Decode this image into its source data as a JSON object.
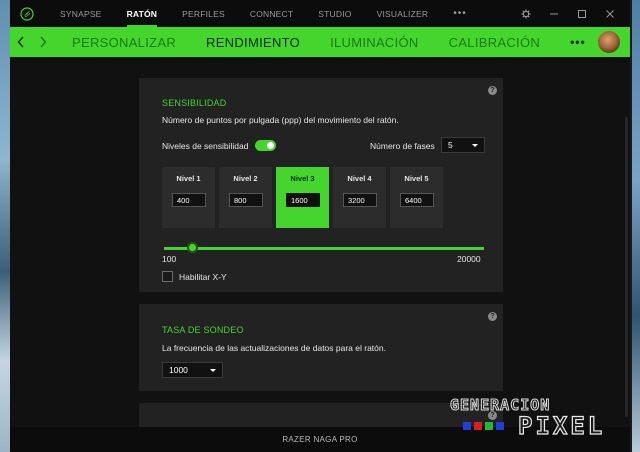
{
  "topnav": {
    "tabs": [
      {
        "label": "SYNAPSE",
        "active": false
      },
      {
        "label": "RATÓN",
        "active": true
      },
      {
        "label": "PERFILES",
        "active": false
      },
      {
        "label": "CONNECT",
        "active": false
      },
      {
        "label": "STUDIO",
        "active": false
      },
      {
        "label": "VISUALIZER",
        "active": false
      }
    ],
    "more": "•••"
  },
  "subnav": {
    "tabs": [
      {
        "label": "PERSONALIZAR",
        "active": false
      },
      {
        "label": "RENDIMIENTO",
        "active": true
      },
      {
        "label": "ILUMINACIÓN",
        "active": false
      },
      {
        "label": "CALIBRACIÓN",
        "active": false
      }
    ],
    "more": "•••"
  },
  "sensitivity": {
    "title": "SENSIBILIDAD",
    "description": "Número de puntos por pulgada (ppp) del movimiento del ratón.",
    "levels_label": "Niveles de sensibilidad",
    "levels_enabled": true,
    "stages_label": "Número de fases",
    "stages_value": "5",
    "levels": [
      {
        "name": "Nivel 1",
        "value": "400",
        "active": false
      },
      {
        "name": "Nivel 2",
        "value": "800",
        "active": false
      },
      {
        "name": "Nivel 3",
        "value": "1600",
        "active": true
      },
      {
        "name": "Nivel 4",
        "value": "3200",
        "active": false
      },
      {
        "name": "Nivel 5",
        "value": "6400",
        "active": false
      }
    ],
    "slider_min": "100",
    "slider_max": "20000",
    "slider_value": 1600,
    "xy_label": "Habilitar X-Y",
    "xy_checked": false
  },
  "polling": {
    "title": "TASA DE SONDEO",
    "description": "La frecuencia de las actualizaciones de datos para el ratón.",
    "value": "1000"
  },
  "help_symbol": "?",
  "footer": {
    "device": "RAZER NAGA PRO"
  },
  "watermark": {
    "line1": "GENERACION",
    "line2": "PIXEL"
  },
  "colors": {
    "accent": "#44d62c",
    "background": "#111111",
    "panel": "#222222"
  }
}
